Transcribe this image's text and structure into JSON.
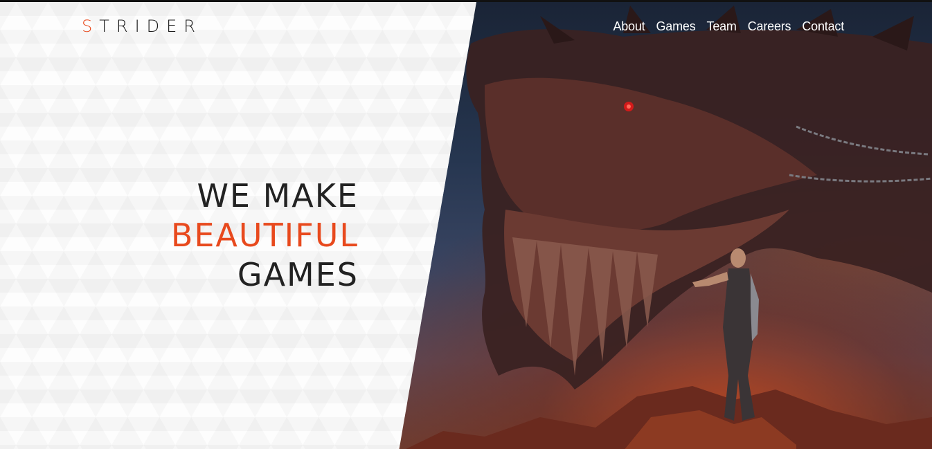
{
  "brand": {
    "logo_first": "S",
    "logo_rest": "TRIDER",
    "accent_color": "#e8491d",
    "text_color": "#222222"
  },
  "nav": {
    "items": [
      {
        "label": "About"
      },
      {
        "label": "Games"
      },
      {
        "label": "Team"
      },
      {
        "label": "Careers"
      },
      {
        "label": "Contact"
      }
    ]
  },
  "hero": {
    "line1": "WE MAKE",
    "line2": "BEAUTIFUL",
    "line3": "GAMES",
    "artwork": "dragon-and-warrior-illustration"
  }
}
